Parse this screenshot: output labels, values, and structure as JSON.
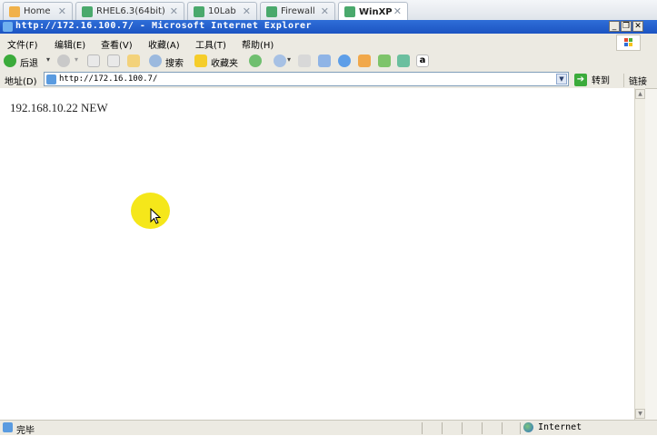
{
  "tabs": [
    {
      "label": "Home",
      "icon": "home-icon",
      "active": false
    },
    {
      "label": "RHEL6.3(64bit)",
      "icon": "vm-icon",
      "active": false
    },
    {
      "label": "10Lab",
      "icon": "vm-icon",
      "active": false
    },
    {
      "label": "Firewall",
      "icon": "vm-icon",
      "active": false
    },
    {
      "label": "WinXP",
      "icon": "vm-icon",
      "active": true
    }
  ],
  "tab_close_glyph": "✕",
  "window": {
    "title": "http://172.16.100.7/ - Microsoft Internet Explorer",
    "minimize_glyph": "_",
    "restore_glyph": "❐",
    "close_glyph": "✕"
  },
  "menu": {
    "items": [
      "文件(F)",
      "编辑(E)",
      "查看(V)",
      "收藏(A)",
      "工具(T)",
      "帮助(H)"
    ]
  },
  "toolbar": {
    "back_label": "后退",
    "search_label": "搜索",
    "favorites_label": "收藏夹",
    "dropdown_glyph": "▾",
    "amazon_glyph": "a"
  },
  "address": {
    "label": "地址(D)",
    "value": "http://172.16.100.7/",
    "go_label": "转到",
    "links_label": "链接",
    "dropdown_glyph": "▼",
    "go_glyph": "➔"
  },
  "page": {
    "text": "192.168.10.22 NEW"
  },
  "status": {
    "text": "完毕",
    "zone": "Internet"
  },
  "colors": {
    "title_bar": "#1c54c2",
    "cursor_highlight": "#f5e71a",
    "go_arrow": "#3bab3b"
  }
}
